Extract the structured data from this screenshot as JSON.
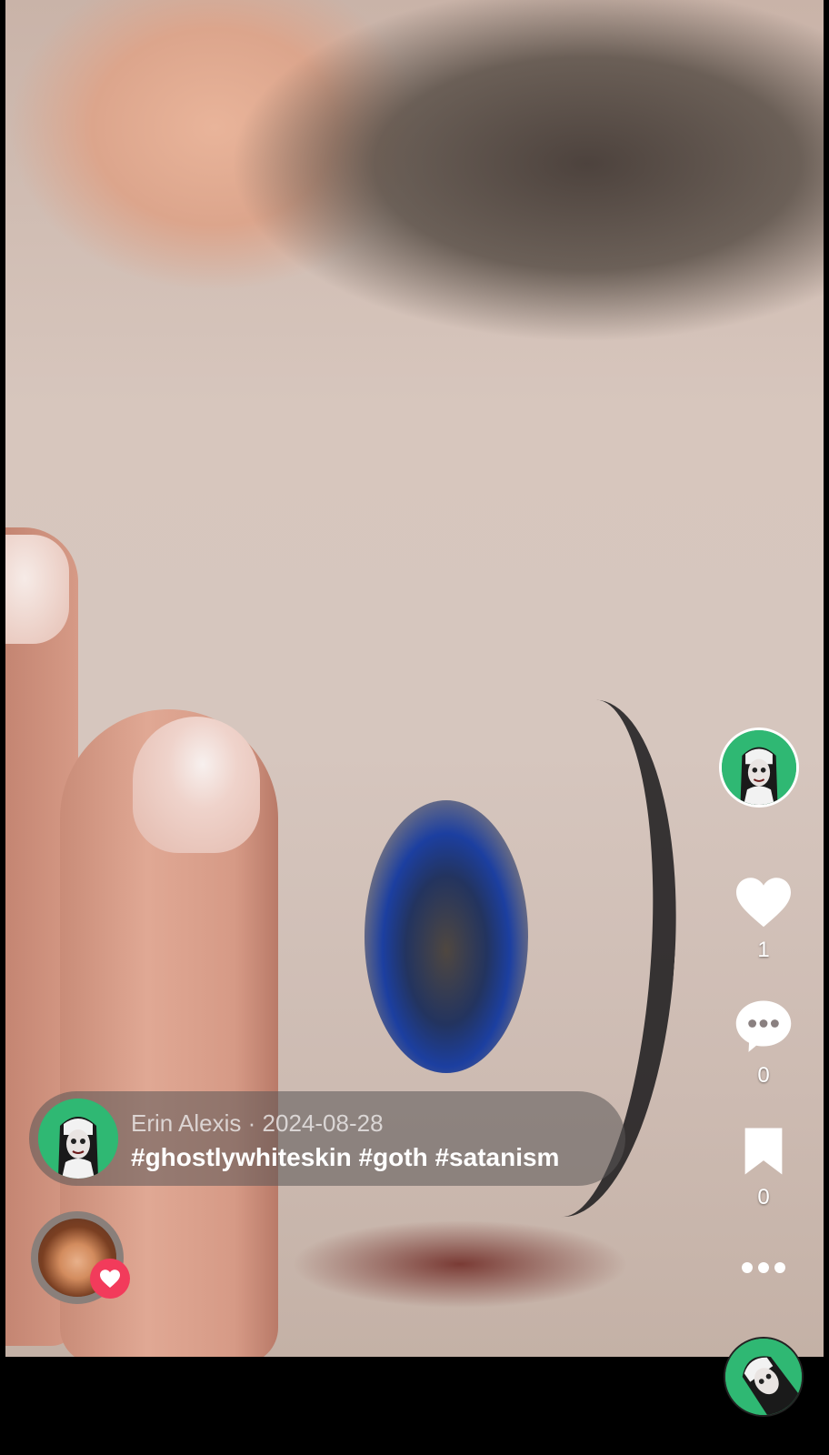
{
  "post": {
    "author": "Erin Alexis",
    "separator": "·",
    "date": "2024-08-28",
    "caption": "#ghostlywhiteskin #goth #satanism"
  },
  "actions": {
    "likes": "1",
    "comments": "0",
    "saves": "0"
  },
  "icons": {
    "like": "heart-icon",
    "comment": "comment-bubble-icon",
    "save": "bookmark-icon",
    "more": "more-dots-icon",
    "liked_badge": "heart-badge-icon"
  },
  "colors": {
    "avatar_bg": "#2fb873",
    "like_badge": "#f23b5b",
    "text": "#ffffff"
  }
}
